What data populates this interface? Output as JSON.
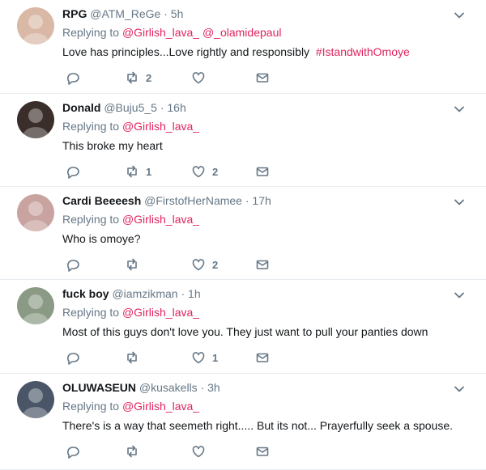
{
  "tweets": [
    {
      "display_name": "RPG",
      "handle": "@ATM_ReGe",
      "time": "5h",
      "replying_prefix": "Replying to",
      "mentions": [
        "@Girlish_lava_",
        "@_olamidepaul"
      ],
      "text": "Love has principles...Love rightly and responsibly",
      "hashtag": "#IstandwithOmoye",
      "retweets": "2",
      "likes": "",
      "avatar_color": "#d9b8a6"
    },
    {
      "display_name": "Donald",
      "handle": "@Buju5_5",
      "time": "16h",
      "replying_prefix": "Replying to",
      "mentions": [
        "@Girlish_lava_"
      ],
      "text": "This broke my heart",
      "hashtag": "",
      "retweets": "1",
      "likes": "2",
      "avatar_color": "#3a2e2a"
    },
    {
      "display_name": "Cardi Beeeesh",
      "handle": "@FirstofHerNamee",
      "time": "17h",
      "replying_prefix": "Replying to",
      "mentions": [
        "@Girlish_lava_"
      ],
      "text": "Who is omoye?",
      "hashtag": "",
      "retweets": "",
      "likes": "2",
      "avatar_color": "#c9a3a0"
    },
    {
      "display_name": "fuck boy",
      "handle": "@iamzikman",
      "time": "1h",
      "replying_prefix": "Replying to",
      "mentions": [
        "@Girlish_lava_"
      ],
      "text": "Most of this guys don't love you. They just want to pull your panties down",
      "hashtag": "",
      "retweets": "",
      "likes": "1",
      "avatar_color": "#8a9a84"
    },
    {
      "display_name": "OLUWASEUN",
      "handle": "@kusakells",
      "time": "3h",
      "replying_prefix": "Replying to",
      "mentions": [
        "@Girlish_lava_"
      ],
      "text": "There's is a way that seemeth right..... But its not... Prayerfully seek a spouse.",
      "hashtag": "",
      "retweets": "",
      "likes": "",
      "avatar_color": "#4a5668"
    }
  ],
  "colors": {
    "link": "#e0245e",
    "muted": "#657786",
    "text": "#14171a",
    "divider": "#e6ecf0"
  },
  "icons": [
    "reply-icon",
    "retweet-icon",
    "like-icon",
    "direct-message-icon",
    "chevron-down-icon"
  ]
}
